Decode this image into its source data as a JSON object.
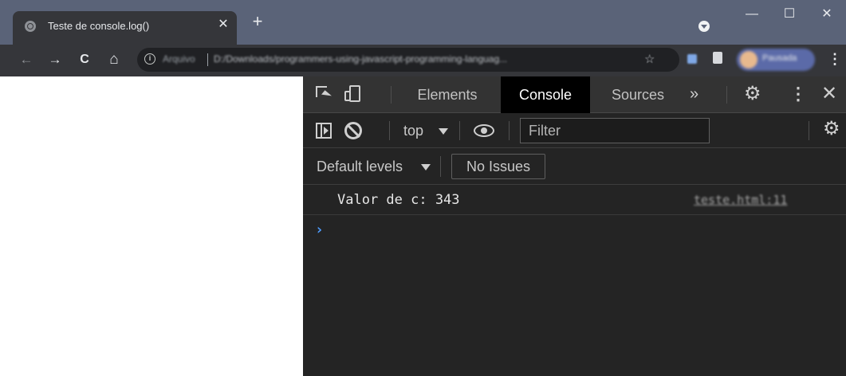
{
  "browser": {
    "tab": {
      "title": "Teste de console.log()",
      "close_glyph": "✕",
      "favicon": "globe-icon"
    },
    "new_tab_glyph": "+",
    "window_controls": {
      "minimize": "—",
      "maximize": "☐",
      "close": "✕"
    },
    "nav": {
      "back": "←",
      "forward": "→",
      "reload": "C",
      "home": "⌂"
    },
    "omnibox": {
      "security_chip": "Arquivo",
      "url": "D:/Downloads/programmers-using-javascript-programming-languag...",
      "bookmark": "☆"
    },
    "profile": {
      "name": "Pausada"
    },
    "menu_glyph": "⋮"
  },
  "devtools": {
    "tabs": [
      {
        "label": "Elements",
        "active": false
      },
      {
        "label": "Console",
        "active": true
      },
      {
        "label": "Sources",
        "active": false
      }
    ],
    "more_tabs_glyph": "»",
    "kebab_glyph": "⋮",
    "close_glyph": "✕",
    "console": {
      "context": "top",
      "filter_placeholder": "Filter",
      "levels": "Default levels",
      "issues_label": "No Issues",
      "messages": [
        {
          "text": "Valor de c: 343",
          "source": "teste.html:11"
        }
      ],
      "prompt_glyph": "›"
    },
    "colors": {
      "background": "#242424",
      "tabbar": "#333333",
      "active_tab": "#000000",
      "prompt": "#4e9cff"
    }
  }
}
